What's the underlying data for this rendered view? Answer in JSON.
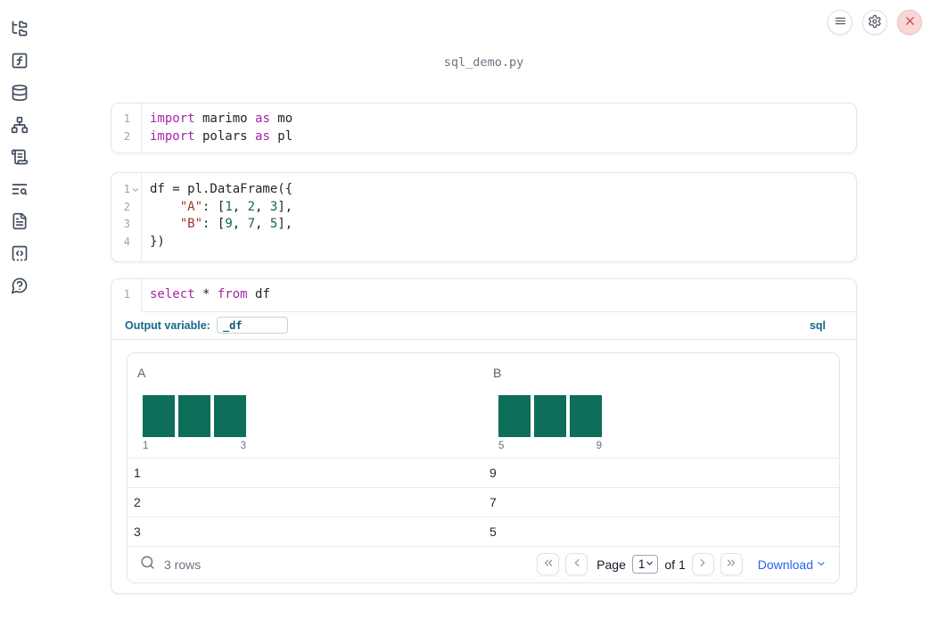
{
  "app": {
    "title": "sql_demo.py"
  },
  "sidebar": {
    "icons": [
      "folder-tree-icon",
      "function-square-icon",
      "database-icon",
      "network-icon",
      "scroll-text-icon",
      "text-search-icon",
      "file-text-icon",
      "code-square-dashed-icon",
      "help-bubble-icon"
    ]
  },
  "header": {
    "icons": [
      "menu-icon",
      "settings-icon",
      "close-icon"
    ]
  },
  "cells": [
    {
      "type": "python",
      "lines": [
        {
          "n": "1",
          "tokens": [
            [
              "kw",
              "import"
            ],
            [
              "pl",
              " marimo "
            ],
            [
              "kw",
              "as"
            ],
            [
              "pl",
              " mo"
            ]
          ]
        },
        {
          "n": "2",
          "tokens": [
            [
              "kw",
              "import"
            ],
            [
              "pl",
              " polars "
            ],
            [
              "kw",
              "as"
            ],
            [
              "pl",
              " pl"
            ]
          ]
        }
      ]
    },
    {
      "type": "python",
      "lines": [
        {
          "n": "1",
          "fold": true,
          "tokens": [
            [
              "pl",
              "df = pl.DataFrame({"
            ]
          ]
        },
        {
          "n": "2",
          "tokens": [
            [
              "pl",
              "    "
            ],
            [
              "str",
              "\"A\""
            ],
            [
              "pl",
              ": ["
            ],
            [
              "num",
              "1"
            ],
            [
              "pl",
              ", "
            ],
            [
              "num",
              "2"
            ],
            [
              "pl",
              ", "
            ],
            [
              "num",
              "3"
            ],
            [
              "pl",
              "],"
            ]
          ]
        },
        {
          "n": "3",
          "tokens": [
            [
              "pl",
              "    "
            ],
            [
              "str",
              "\"B\""
            ],
            [
              "pl",
              ": ["
            ],
            [
              "num",
              "9"
            ],
            [
              "pl",
              ", "
            ],
            [
              "num",
              "7"
            ],
            [
              "pl",
              ", "
            ],
            [
              "num",
              "5"
            ],
            [
              "pl",
              "],"
            ]
          ]
        },
        {
          "n": "4",
          "tokens": [
            [
              "pl",
              "})"
            ]
          ]
        }
      ]
    },
    {
      "type": "sql",
      "lines": [
        {
          "n": "1",
          "tokens": [
            [
              "kw",
              "select"
            ],
            [
              "pl",
              " * "
            ],
            [
              "kw",
              "from"
            ],
            [
              "pl",
              " df"
            ]
          ]
        }
      ],
      "toolbar": {
        "output_variable_label": "Output variable:",
        "output_variable_value": "_df",
        "language_label": "sql"
      }
    }
  ],
  "table": {
    "columns": [
      {
        "label": "A",
        "hist": {
          "bars": [
            1,
            1,
            1
          ],
          "min_label": "1",
          "max_label": "3"
        }
      },
      {
        "label": "B",
        "hist": {
          "bars": [
            1,
            1,
            1
          ],
          "min_label": "5",
          "max_label": "9"
        }
      }
    ],
    "rows": [
      [
        "1",
        "9"
      ],
      [
        "2",
        "7"
      ],
      [
        "3",
        "5"
      ]
    ],
    "footer": {
      "row_count": "3 rows",
      "page_label": "Page",
      "page_value": "1",
      "of_label": "of 1",
      "download_label": "Download"
    }
  },
  "colors": {
    "histogram_bar": "#0d6e5a",
    "sql_accent": "#15688c",
    "link": "#2563eb",
    "syntax_keyword": "#a626a4",
    "syntax_string": "#a5342d",
    "syntax_number": "#116644",
    "close_button_bg": "#f9d7d7",
    "close_button_icon": "#d64545",
    "sidebar_icon": "#3e4a5e"
  }
}
